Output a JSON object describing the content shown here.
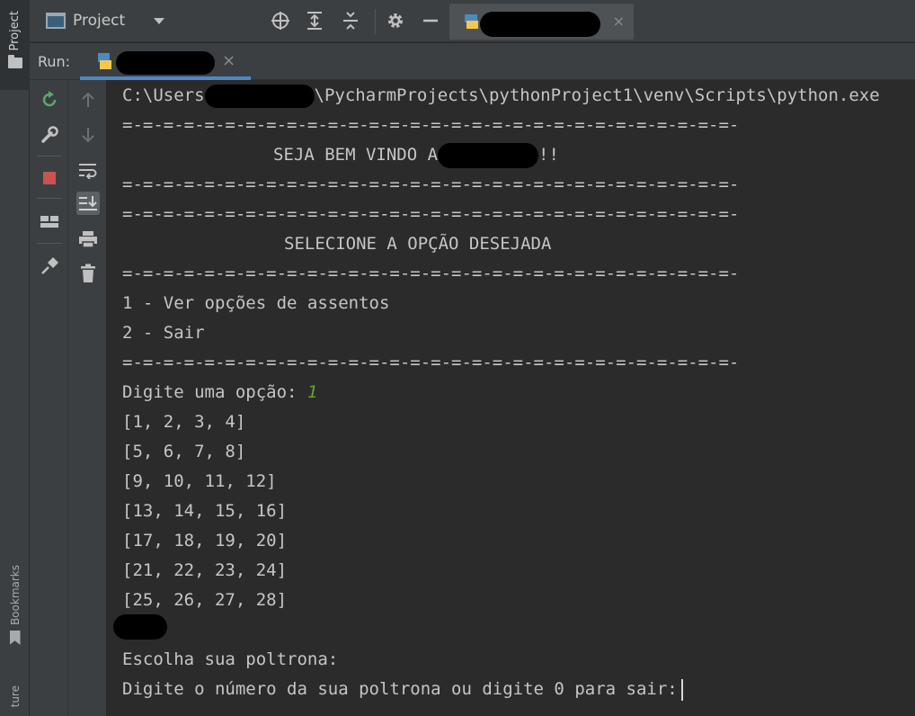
{
  "left_strip": {
    "project_label": "Project",
    "bookmarks_label": "Bookmarks",
    "structure_label": "ture"
  },
  "toolbar": {
    "project_selector": "Project",
    "icons": [
      "target-icon",
      "expand-all-icon",
      "collapse-all-icon",
      "gear-icon",
      "minus-icon"
    ],
    "editor_tab_close": "×"
  },
  "run": {
    "label": "Run:",
    "tab_close": "×",
    "tools_col1": [
      "rerun-icon",
      "wrench-icon",
      "stop-icon",
      "layout-icon",
      "pin-icon"
    ],
    "tools_col2": [
      "up-arrow-icon",
      "down-arrow-icon",
      "soft-wrap-icon",
      "scroll-to-end-icon",
      "print-icon",
      "trash-icon"
    ]
  },
  "console": {
    "path_prefix": "C:\\Users",
    "path_suffix": "\\PycharmProjects\\pythonProject1\\venv\\Scripts\\python.exe",
    "separator": "=-=-=-=-=-=-=-=-=-=-=-=-=-=-=-=-=-=-=-=-=-=-=-=-=-=-=-=-=-=-",
    "welcome_prefix": "SEJA BEM VINDO A",
    "welcome_suffix": "!!",
    "select_title": "SELECIONE A OPÇÃO DESEJADA",
    "option_1": "1 - Ver opções de assentos",
    "option_2": "2 - Sair",
    "prompt_option": "Digite uma opção: ",
    "option_input": "1",
    "seat_rows": [
      "[1, 2, 3, 4]",
      "[5, 6, 7, 8]",
      "[9, 10, 11, 12]",
      "[13, 14, 15, 16]",
      "[17, 18, 19, 20]",
      "[21, 22, 23, 24]",
      "[25, 26, 27, 28]"
    ],
    "choose_seat": "Escolha sua poltrona:",
    "seat_prompt": "Digite o número da sua poltrona ou digite 0 para sair:"
  },
  "colors": {
    "background": "#2b2b2b",
    "panel": "#3c3f41",
    "accent": "#4a88c7",
    "input_green": "#5fa62f",
    "stop_red": "#c75450"
  }
}
